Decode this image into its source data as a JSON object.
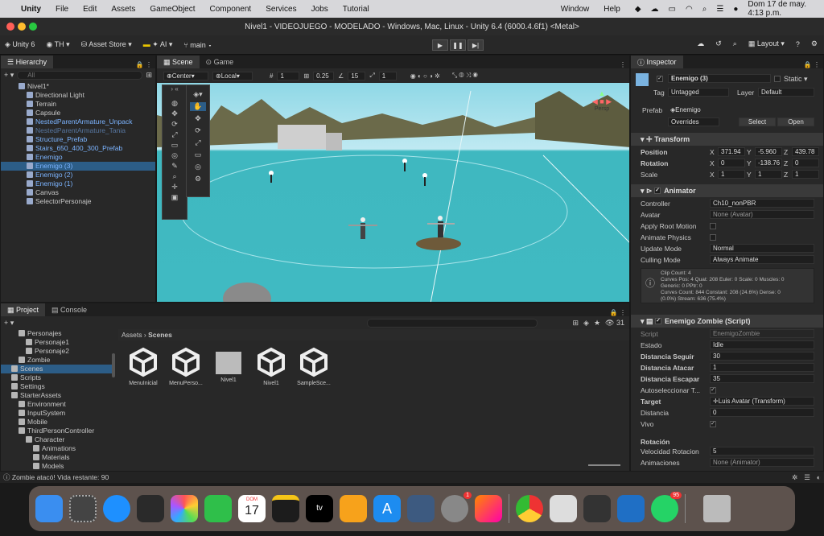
{
  "menubar": {
    "app": "Unity",
    "items": [
      "File",
      "Edit",
      "Assets",
      "GameObject",
      "Component",
      "Services",
      "Jobs",
      "Tutorial"
    ],
    "window": "Window",
    "help": "Help",
    "clock": "Dom 17 de may.  4:13 p.m."
  },
  "titlebar": {
    "title": "Nivel1 - VIDEOJUEGO - MODELADO - Windows, Mac, Linux - Unity 6.4 (6000.4.6f1) <Metal>"
  },
  "toolbar": {
    "unity": "Unity 6",
    "account": "TH",
    "asset_store": "Asset Store",
    "ai": "AI",
    "branch": "main",
    "layout": "Layout"
  },
  "hierarchy": {
    "tab": "Hierarchy",
    "search_placeholder": "All",
    "items": [
      {
        "label": "Nivel1*",
        "indent": 1,
        "kind": "scene"
      },
      {
        "label": "Directional Light",
        "indent": 2,
        "kind": "obj"
      },
      {
        "label": "Terrain",
        "indent": 2,
        "kind": "obj"
      },
      {
        "label": "Capsule",
        "indent": 2,
        "kind": "obj"
      },
      {
        "label": "NestedParentArmature_Unpack",
        "indent": 2,
        "kind": "prefab"
      },
      {
        "label": "NestedParentArmature_Tania",
        "indent": 2,
        "kind": "prefab-dim"
      },
      {
        "label": "Structure_Prefab",
        "indent": 2,
        "kind": "prefab"
      },
      {
        "label": "Stairs_650_400_300_Prefab",
        "indent": 2,
        "kind": "prefab"
      },
      {
        "label": "Enemigo",
        "indent": 2,
        "kind": "prefab"
      },
      {
        "label": "Enemigo (3)",
        "indent": 2,
        "kind": "prefab-sel"
      },
      {
        "label": "Enemigo (2)",
        "indent": 2,
        "kind": "prefab"
      },
      {
        "label": "Enemigo (1)",
        "indent": 2,
        "kind": "prefab"
      },
      {
        "label": "Canvas",
        "indent": 2,
        "kind": "obj"
      },
      {
        "label": "SelectorPersonaje",
        "indent": 2,
        "kind": "obj"
      }
    ]
  },
  "scene": {
    "tab_scene": "Scene",
    "tab_game": "Game",
    "pivot": "Center",
    "space": "Local",
    "grid": "1",
    "snap": "0.25",
    "angle": "15",
    "scale": "1",
    "persp": "Persp"
  },
  "project": {
    "tab_project": "Project",
    "tab_console": "Console",
    "breadcrumb_root": "Assets",
    "breadcrumb_leaf": "Scenes",
    "count": "31",
    "tree": [
      {
        "label": "Personajes",
        "indent": 2
      },
      {
        "label": "Personaje1",
        "indent": 3
      },
      {
        "label": "Personaje2",
        "indent": 3
      },
      {
        "label": "Zombie",
        "indent": 2
      },
      {
        "label": "Scenes",
        "indent": 1,
        "sel": true
      },
      {
        "label": "Scripts",
        "indent": 1
      },
      {
        "label": "Settings",
        "indent": 1
      },
      {
        "label": "StarterAssets",
        "indent": 1
      },
      {
        "label": "Environment",
        "indent": 2
      },
      {
        "label": "InputSystem",
        "indent": 2
      },
      {
        "label": "Mobile",
        "indent": 2
      },
      {
        "label": "ThirdPersonController",
        "indent": 2
      },
      {
        "label": "Character",
        "indent": 3
      },
      {
        "label": "Animations",
        "indent": 4
      },
      {
        "label": "Materials",
        "indent": 4
      },
      {
        "label": "Models",
        "indent": 4
      }
    ],
    "assets": [
      "MenuInicial",
      "MenuPerso...",
      "Nivel1",
      "Nivel1",
      "SampleSce..."
    ]
  },
  "status": {
    "message": "Zombie atacó! Vida restante: 90"
  },
  "inspector": {
    "tab": "Inspector",
    "name": "Enemigo (3)",
    "static": "Static",
    "tag_label": "Tag",
    "tag": "Untagged",
    "layer_label": "Layer",
    "layer": "Default",
    "prefab_label": "Prefab",
    "prefab": "Enemigo",
    "overrides": "Overrides",
    "select": "Select",
    "open": "Open",
    "transform": {
      "title": "Transform",
      "position_label": "Position",
      "rotation_label": "Rotation",
      "scale_label": "Scale",
      "pos": [
        "371.94",
        "-5.960",
        "439.78"
      ],
      "rot": [
        "0",
        "-138.76",
        "0"
      ],
      "scl": [
        "1",
        "1",
        "1"
      ]
    },
    "animator": {
      "title": "Animator",
      "controller_label": "Controller",
      "controller": "Ch10_nonPBR",
      "avatar_label": "Avatar",
      "avatar": "None (Avatar)",
      "root_motion": "Apply Root Motion",
      "physics": "Animate Physics",
      "update_label": "Update Mode",
      "update": "Normal",
      "culling_label": "Culling Mode",
      "culling": "Always Animate",
      "info": [
        "Clip Count: 4",
        "Curves Pos: 4 Quat: 208 Euler: 0 Scale: 0 Muscles: 0",
        "Generic: 0 PPtr: 0",
        "Curves Count: 844 Constant: 208 (24.6%) Dense: 0",
        "(0.0%) Stream: 636 (75.4%)"
      ]
    },
    "script": {
      "title": "Enemigo Zombie (Script)",
      "script_label": "Script",
      "script": "EnemigoZombie",
      "estado_label": "Estado",
      "estado": "Idle",
      "seguir_label": "Distancia Seguir",
      "seguir": "30",
      "atacar_label": "Distancia Atacar",
      "atacar": "1",
      "escapar_label": "Distancia Escapar",
      "escapar": "35",
      "auto_label": "Autoseleccionar T...",
      "target_label": "Target",
      "target": "Luis Avatar (Transform)",
      "distancia_label": "Distancia",
      "distancia": "0",
      "vivo_label": "Vivo",
      "rotacion_header": "Rotación",
      "vel_label": "Velocidad Rotacion",
      "vel": "5",
      "anim_label": "Animaciones",
      "anim": "None (Animator)"
    }
  },
  "dock": {
    "calendar_month": "DOM",
    "calendar_day": "17",
    "badge_settings": "1",
    "badge_whatsapp": "95"
  },
  "colors": {
    "accent": "#2c5d87",
    "prefab": "#7cb4ff",
    "water": "#3fb8c0",
    "sky": "#8fd8e6"
  }
}
